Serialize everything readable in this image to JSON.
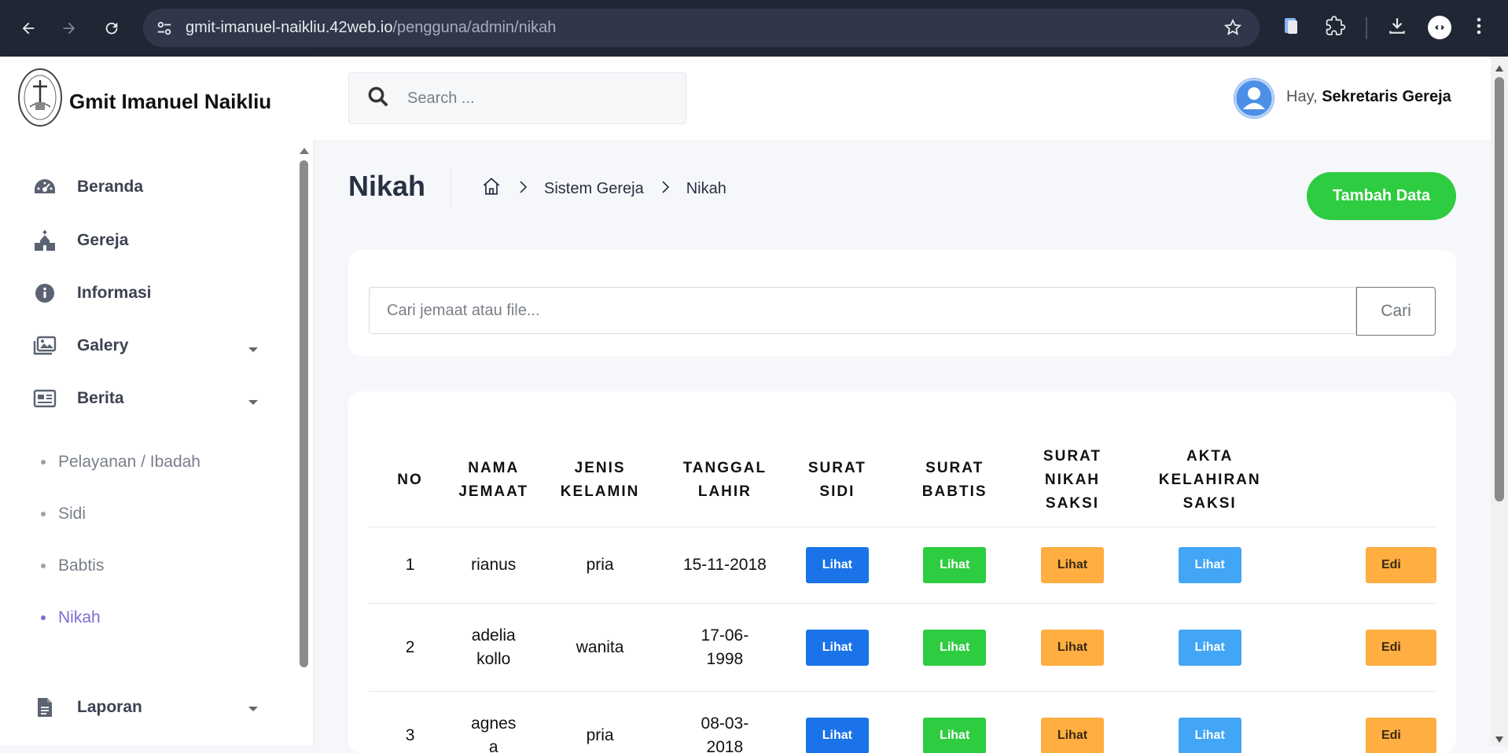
{
  "browser": {
    "url_host": "gmit-imanuel-naikliu.42web.io",
    "url_path": "/pengguna/admin/nikah"
  },
  "sidebar": {
    "brand": "Gmit Imanuel Naikliu",
    "items": [
      {
        "label": "Beranda",
        "icon": "dashboard-icon"
      },
      {
        "label": "Gereja",
        "icon": "church-icon"
      },
      {
        "label": "Informasi",
        "icon": "info-icon",
        "has_caret": true
      },
      {
        "label": "Galery",
        "icon": "gallery-icon"
      },
      {
        "label": "Berita",
        "icon": "news-icon",
        "has_caret": true
      },
      {
        "label": "Laporan",
        "icon": "report-icon",
        "has_caret": true
      }
    ],
    "subitems": [
      {
        "label": "Pelayanan / Ibadah",
        "active": false
      },
      {
        "label": "Sidi",
        "active": false
      },
      {
        "label": "Babtis",
        "active": false
      },
      {
        "label": "Nikah",
        "active": true
      }
    ]
  },
  "header": {
    "search_placeholder": "Search ...",
    "greeting_prefix": "Hay,",
    "user_name": "Sekretaris Gereja"
  },
  "page": {
    "title": "Nikah",
    "breadcrumb": [
      "Sistem Gereja",
      "Nikah"
    ],
    "add_button": "Tambah Data"
  },
  "filter": {
    "placeholder": "Cari jemaat atau file...",
    "button": "Cari"
  },
  "table": {
    "headers": [
      [
        "NO"
      ],
      [
        "NAMA",
        "JEMAAT"
      ],
      [
        "JENIS",
        "KELAMIN"
      ],
      [
        "TANGGAL",
        "LAHIR"
      ],
      [
        "SURAT",
        "SIDI"
      ],
      [
        "SURAT",
        "BABTIS"
      ],
      [
        "SURAT",
        "NIKAH",
        "SAKSI"
      ],
      [
        "AKTA",
        "KELAHIRAN",
        "SAKSI"
      ]
    ],
    "view_label": "Lihat",
    "edit_label": "Edi",
    "rows": [
      {
        "no": "1",
        "nama": [
          "rianus"
        ],
        "jenis": "pria",
        "tanggal": [
          "15-11-2018"
        ]
      },
      {
        "no": "2",
        "nama": [
          "adelia",
          "kollo"
        ],
        "jenis": "wanita",
        "tanggal": [
          "17-06-",
          "1998"
        ]
      },
      {
        "no": "3",
        "nama": [
          "agnes",
          "a"
        ],
        "jenis": "pria",
        "tanggal": [
          "08-03-",
          "2018"
        ]
      }
    ]
  },
  "colors": {
    "accent_green": "#2ecc40",
    "btn_blue": "#1a73e8",
    "btn_orange": "#ffae42",
    "btn_sky": "#42a5f5",
    "active_menu": "#7c6fce"
  }
}
